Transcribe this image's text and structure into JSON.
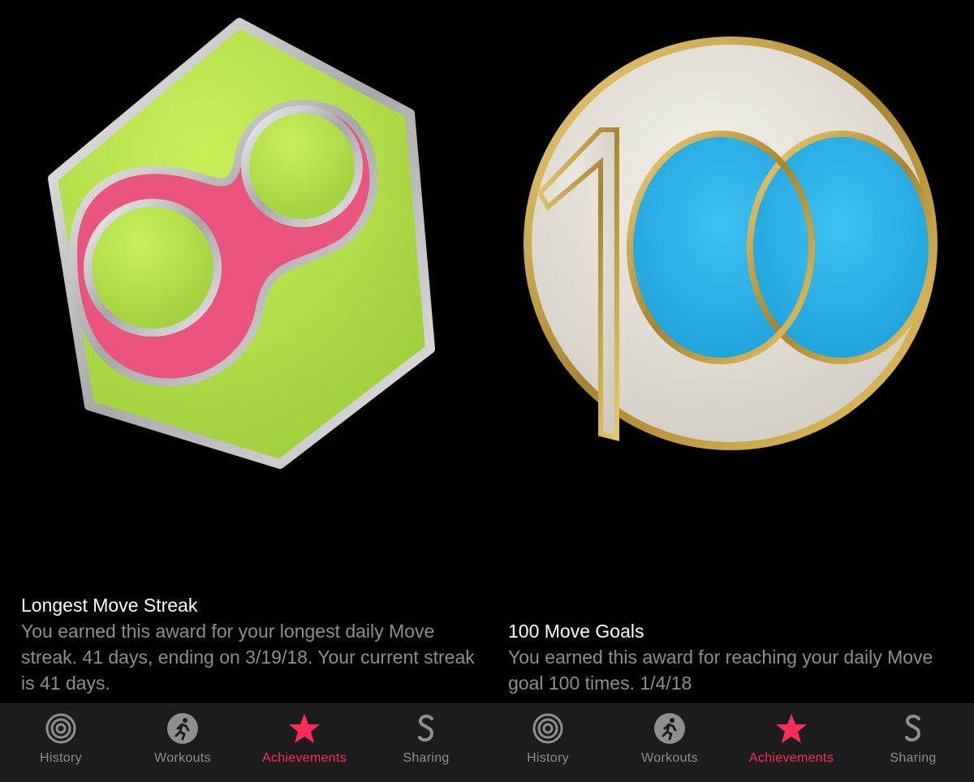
{
  "colors": {
    "background": "#000000",
    "tabbar": "#1c1c1e",
    "accent": "#ff2d55",
    "inactive": "#8e8e93",
    "streak_green": "#b3e04c",
    "streak_pink": "#e94e7c",
    "goals_blue": "#2eb0ea",
    "goals_gold": "#c9a641"
  },
  "left": {
    "badge_icon": "infinity-streak-badge",
    "title": "Longest Move Streak",
    "description": "You earned this award for your longest daily Move streak. 41 days, ending on 3/19/18. Your current streak is 41 days.",
    "tabs": [
      {
        "label": "History",
        "icon": "history-rings-icon"
      },
      {
        "label": "Workouts",
        "icon": "running-figure-icon"
      },
      {
        "label": "Achievements",
        "icon": "star-icon",
        "active": true
      },
      {
        "label": "Sharing",
        "icon": "sharing-s-icon"
      }
    ]
  },
  "right": {
    "badge_icon": "100-goals-badge",
    "title": "100 Move Goals",
    "description": "You earned this award for reaching your daily Move goal 100 times. 1/4/18",
    "tabs": [
      {
        "label": "History",
        "icon": "history-rings-icon"
      },
      {
        "label": "Workouts",
        "icon": "running-figure-icon"
      },
      {
        "label": "Achievements",
        "icon": "star-icon",
        "active": true
      },
      {
        "label": "Sharing",
        "icon": "sharing-s-icon"
      }
    ]
  }
}
